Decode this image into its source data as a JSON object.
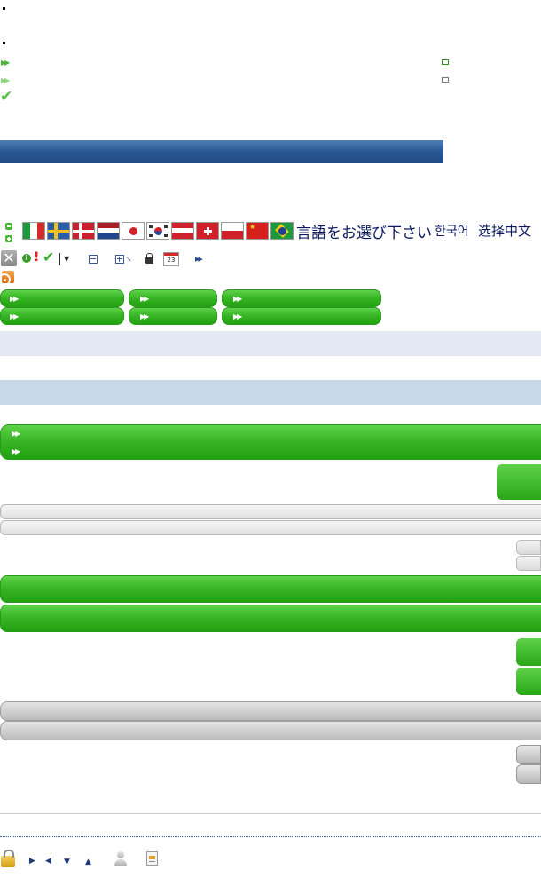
{
  "languages": {
    "japanese": "言語をお選び下さい",
    "korean": "한국어",
    "chinese": "选择中文"
  },
  "calendar": {
    "day": "23"
  },
  "flags": [
    "italy",
    "sweden",
    "denmark",
    "netherlands",
    "japan",
    "south-korea",
    "austria",
    "switzerland",
    "poland",
    "china",
    "brazil"
  ],
  "colors": {
    "accent_green": "#36b423",
    "header_blue": "#2a5692",
    "light_blue_band": "#e3e9f3",
    "blue_band": "#c9d8e8"
  }
}
